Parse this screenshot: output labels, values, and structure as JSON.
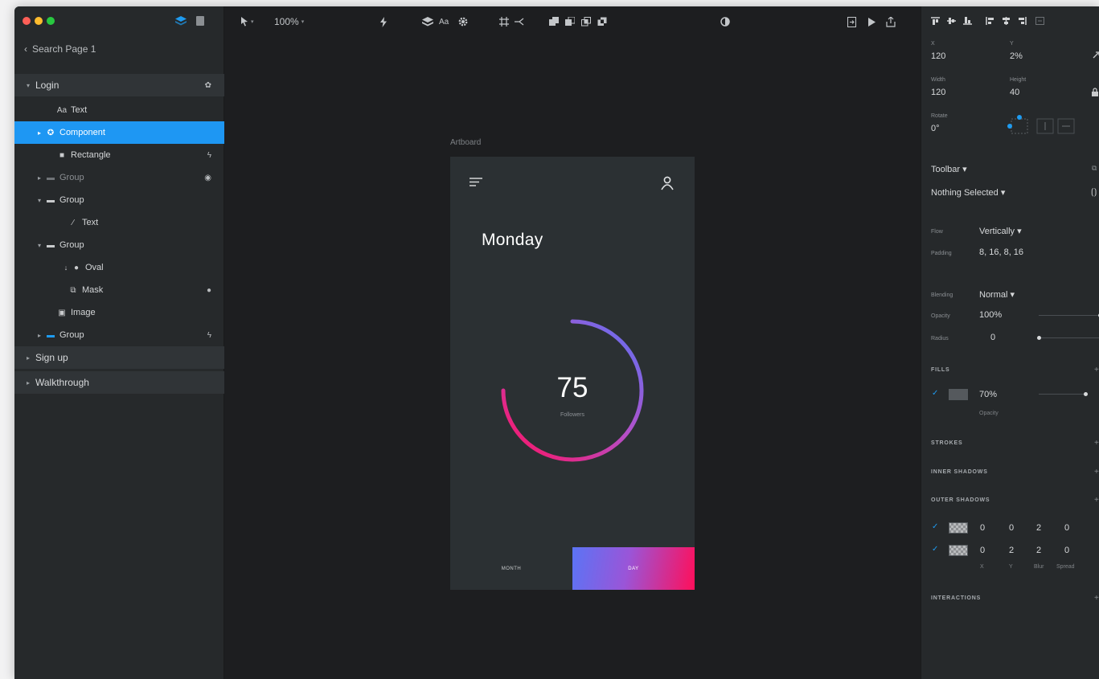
{
  "colors": {
    "accent": "#1e9bf0",
    "selection": "#1e97f3",
    "gradient_start": "#5b74f5",
    "gradient_end": "#ff0f5a"
  },
  "sidebar": {
    "back_label": "Search Page 1",
    "layers": [
      {
        "name": "Login",
        "icon": "page-icon",
        "kind": "section",
        "caret": "▾",
        "indent": 0,
        "right_icon": "gear-icon"
      },
      {
        "name": "Text",
        "icon": "text-icon",
        "kind": "item",
        "indent": 2,
        "glyph": "Aa"
      },
      {
        "name": "Component",
        "icon": "component-icon",
        "kind": "selected",
        "caret": "▸",
        "indent": 1,
        "glyph": "✪"
      },
      {
        "name": "Rectangle",
        "icon": "rectangle-icon",
        "kind": "item",
        "indent": 2,
        "glyph": "■",
        "right_icon": "bolt-icon"
      },
      {
        "name": "Group",
        "icon": "folder-icon",
        "kind": "item",
        "caret": "▸",
        "indent": 1,
        "glyph": "▬",
        "right_icon": "eye-icon",
        "dim": true
      },
      {
        "name": "Group",
        "icon": "folder-icon",
        "kind": "item",
        "caret": "▾",
        "indent": 1,
        "glyph": "▬"
      },
      {
        "name": "Text",
        "icon": "pen-icon",
        "kind": "item",
        "indent": 3,
        "glyph": "∕"
      },
      {
        "name": "Group",
        "icon": "folder-icon",
        "kind": "item",
        "caret": "▾",
        "indent": 1,
        "glyph": "▬"
      },
      {
        "name": "Oval",
        "icon": "oval-icon",
        "kind": "item",
        "indent": 3,
        "glyph": "●",
        "pre": "↓"
      },
      {
        "name": "Mask",
        "icon": "mask-icon",
        "kind": "item",
        "indent": 3,
        "glyph": "⧉",
        "right_icon": "mask-toggle-icon"
      },
      {
        "name": "Image",
        "icon": "image-icon",
        "kind": "item",
        "indent": 2,
        "glyph": "▣"
      },
      {
        "name": "Group",
        "icon": "folder-blue-icon",
        "kind": "item",
        "caret": "▸",
        "indent": 1,
        "glyph": "▬",
        "blue": true,
        "right_icon": "bolt-icon"
      },
      {
        "name": "Sign up",
        "icon": "page-icon",
        "kind": "section",
        "caret": "▸",
        "indent": 0
      },
      {
        "name": "Walkthrough",
        "icon": "page-icon",
        "kind": "section",
        "caret": "▸",
        "indent": 0
      }
    ]
  },
  "toolbar": {
    "zoom": "100%"
  },
  "canvas": {
    "artboard_label": "Artboard",
    "day": "Monday",
    "count": "75",
    "count_label": "Followers",
    "progress": 0.75,
    "tab_left": "MONTH",
    "tab_right": "DAY"
  },
  "inspector": {
    "x_label": "X",
    "x_value": "120",
    "y_label": "Y",
    "y_value": "2%",
    "width_label": "Width",
    "width_value": "120",
    "height_label": "Height",
    "height_value": "40",
    "rotate_label": "Rotate",
    "rotate_value": "0°",
    "toolbar_label": "Toolbar ▾",
    "selection_label": "Nothing Selected ▾",
    "flow_label": "Flow",
    "flow_value": "Vertically ▾",
    "padding_label": "Padding",
    "padding_value": "8, 16, 8, 16",
    "blending_label": "Blending",
    "blending_value": "Normal ▾",
    "opacity_label": "Opacity",
    "opacity_value": "100%",
    "opacity_level": 1.0,
    "radius_label": "Radius",
    "radius_value": "0",
    "radius_level": 0.0,
    "fills_head": "FILLS",
    "fill_opacity": "70%",
    "fill_opacity_label": "Opacity",
    "fill_level": 0.7,
    "strokes_head": "STROKES",
    "inner_shadows_head": "INNER SHADOWS",
    "outer_shadows_head": "OUTER SHADOWS",
    "shadows": [
      {
        "x": "0",
        "y": "0",
        "blur": "2",
        "spread": "0"
      },
      {
        "x": "0",
        "y": "2",
        "blur": "2",
        "spread": "0"
      }
    ],
    "shadow_col_labels": {
      "x": "X",
      "y": "Y",
      "blur": "Blur",
      "spread": "Spread"
    },
    "interactions_head": "INTERACTIONS"
  }
}
